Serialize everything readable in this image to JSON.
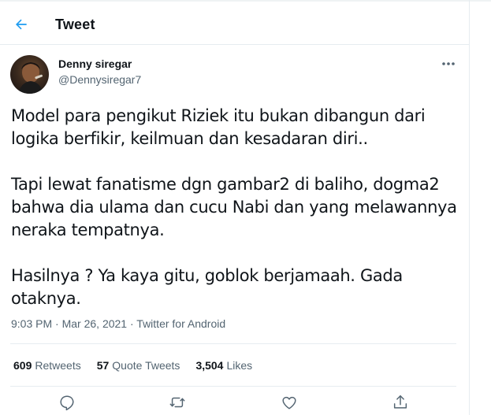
{
  "header": {
    "title": "Tweet",
    "back_icon": "arrow-left-icon",
    "accent": "#1d9bf0"
  },
  "author": {
    "name": "Denny siregar",
    "handle": "@Dennysiregar7",
    "more_icon": "more-icon"
  },
  "tweet": {
    "paragraphs": [
      [
        "Model para pengikut Riziek itu bukan dibangun dari",
        "logika berfikir, keilmuan dan kesadaran diri.."
      ],
      [
        "Tapi lewat fanatisme dgn gambar2 di baliho, dogma2",
        "bahwa dia ulama dan cucu Nabi dan yang melawannya",
        "neraka tempatnya."
      ],
      [
        "Hasilnya ? Ya kaya gitu, goblok berjamaah. Gada",
        "otaknya."
      ]
    ],
    "time": "9:03 PM",
    "date": "Mar 26, 2021",
    "separator": "·",
    "source": "Twitter for Android"
  },
  "stats": {
    "retweets_count": "609",
    "retweets_label": "Retweets",
    "quotes_count": "57",
    "quotes_label": "Quote Tweets",
    "likes_count": "3,504",
    "likes_label": "Likes"
  },
  "actions": {
    "icons": [
      "reply-icon",
      "retweet-icon",
      "like-icon",
      "share-icon"
    ]
  }
}
